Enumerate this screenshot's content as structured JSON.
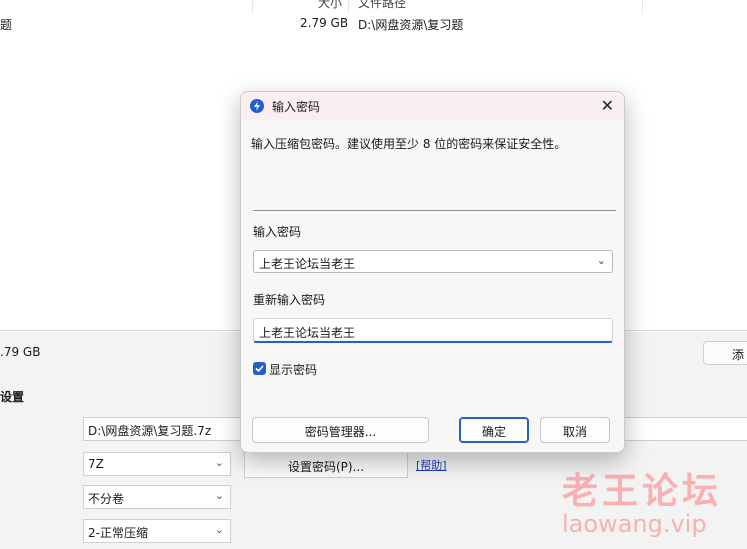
{
  "window": {
    "header_size": "大小",
    "header_path": "文件路径",
    "row_name": "题",
    "row_size": "2.79 GB",
    "row_path": "D:\\网盘资源\\复习题",
    "status_size": ".79 GB",
    "add_button": "添",
    "section_title": "设置",
    "archive_path": "D:\\网盘资源\\复习题.7z",
    "format": "7Z",
    "split": "不分卷",
    "level": "2-正常压缩",
    "set_password_button": "设置密码(P)...",
    "help_link": "[帮助]"
  },
  "dialog": {
    "title": "输入密码",
    "description": "输入压缩包密码。建议使用至少 8 位的密码来保证安全性。",
    "password_label": "输入密码",
    "password_value": "上老王论坛当老王",
    "confirm_label": "重新输入密码",
    "confirm_value": "上老王论坛当老王",
    "show_password_label": "显示密码",
    "show_password_checked": true,
    "manager_button": "密码管理器...",
    "ok_button": "确定",
    "cancel_button": "取消",
    "icons": [
      "app-icon",
      "close-icon",
      "chevron-down-icon",
      "checkmark-icon"
    ]
  },
  "watermark": {
    "cn": "老王论坛",
    "url": "laowang.vip"
  },
  "colors": {
    "accent": "#2360c8",
    "title_bar": "#fbeef0",
    "watermark": "#ff7a7a"
  }
}
